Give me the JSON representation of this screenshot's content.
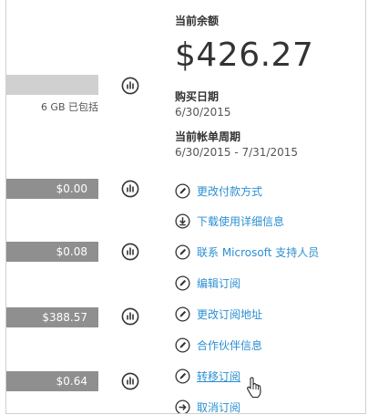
{
  "balance": {
    "label": "当前余额",
    "amount": "$426.27"
  },
  "purchase_date": {
    "label": "购买日期",
    "value": "6/30/2015"
  },
  "billing_period": {
    "label": "当前帐单周期",
    "value": "6/30/2015 - 7/31/2015"
  },
  "usage": {
    "included_text": "6 GB 已包括",
    "items": [
      {
        "amount": "$0.00"
      },
      {
        "amount": "$0.08"
      },
      {
        "amount": "$388.57"
      },
      {
        "amount": "$0.64"
      }
    ]
  },
  "actions": [
    {
      "label": "更改付款方式",
      "icon": "pencil-icon"
    },
    {
      "label": "下载使用详细信息",
      "icon": "download-icon"
    },
    {
      "label": "联系 Microsoft 支持人员",
      "icon": "pencil-icon"
    },
    {
      "label": "编辑订阅",
      "icon": "pencil-icon"
    },
    {
      "label": "更改订阅地址",
      "icon": "pencil-icon"
    },
    {
      "label": "合作伙伴信息",
      "icon": "pencil-icon"
    },
    {
      "label": "转移订阅",
      "icon": "pencil-icon"
    },
    {
      "label": "取消订阅",
      "icon": "arrow-right-icon"
    }
  ],
  "colors": {
    "link": "#2b8fd2",
    "bar": "#8f8f8f",
    "bar_light": "#d0d0d0"
  }
}
